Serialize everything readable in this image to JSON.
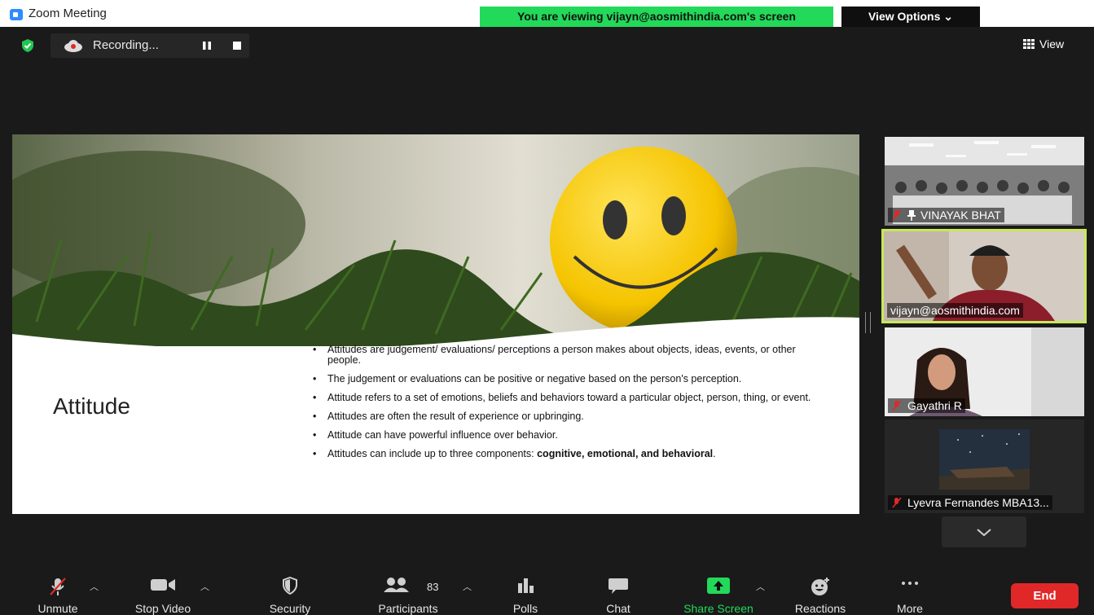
{
  "window": {
    "title": "Zoom Meeting"
  },
  "banner": {
    "text": "You are viewing vijayn@aosmithindia.com's screen",
    "color": "#23d959"
  },
  "view_options": {
    "label": "View Options"
  },
  "recording": {
    "label": "Recording..."
  },
  "view_button": {
    "label": "View"
  },
  "slide": {
    "title": "Attitude",
    "bullets": [
      "Attitudes are judgement/ evaluations/ perceptions a person makes about objects, ideas, events, or other people.",
      "The judgement or evaluations can be positive or negative based on the person's perception.",
      "Attitude refers to a set of emotions, beliefs and behaviors toward a particular object, person, thing, or event.",
      "Attitudes are often the result of experience or upbringing.",
      "Attitude can have powerful influence over behavior.",
      "Attitudes can include up to three components: "
    ],
    "last_bullet_bold": "cognitive, emotional, and behavioral",
    "last_bullet_end": "."
  },
  "participants": [
    {
      "name": "VINAYAK BHAT",
      "muted": true,
      "pinned": true
    },
    {
      "name": "vijayn@aosmithindia.com",
      "active_speaker": true
    },
    {
      "name": "Gayathri R",
      "muted": true
    },
    {
      "name": "Lyevra Fernandes MBA13...",
      "muted": true
    }
  ],
  "toolbar": {
    "unmute": "Unmute",
    "stop_video": "Stop Video",
    "security": "Security",
    "participants": "Participants",
    "participant_count": "83",
    "polls": "Polls",
    "chat": "Chat",
    "share_screen": "Share Screen",
    "reactions": "Reactions",
    "more": "More",
    "end": "End"
  },
  "colors": {
    "accent_green": "#23d959",
    "end_red": "#e02828",
    "speaker_border": "#c8e85a"
  }
}
